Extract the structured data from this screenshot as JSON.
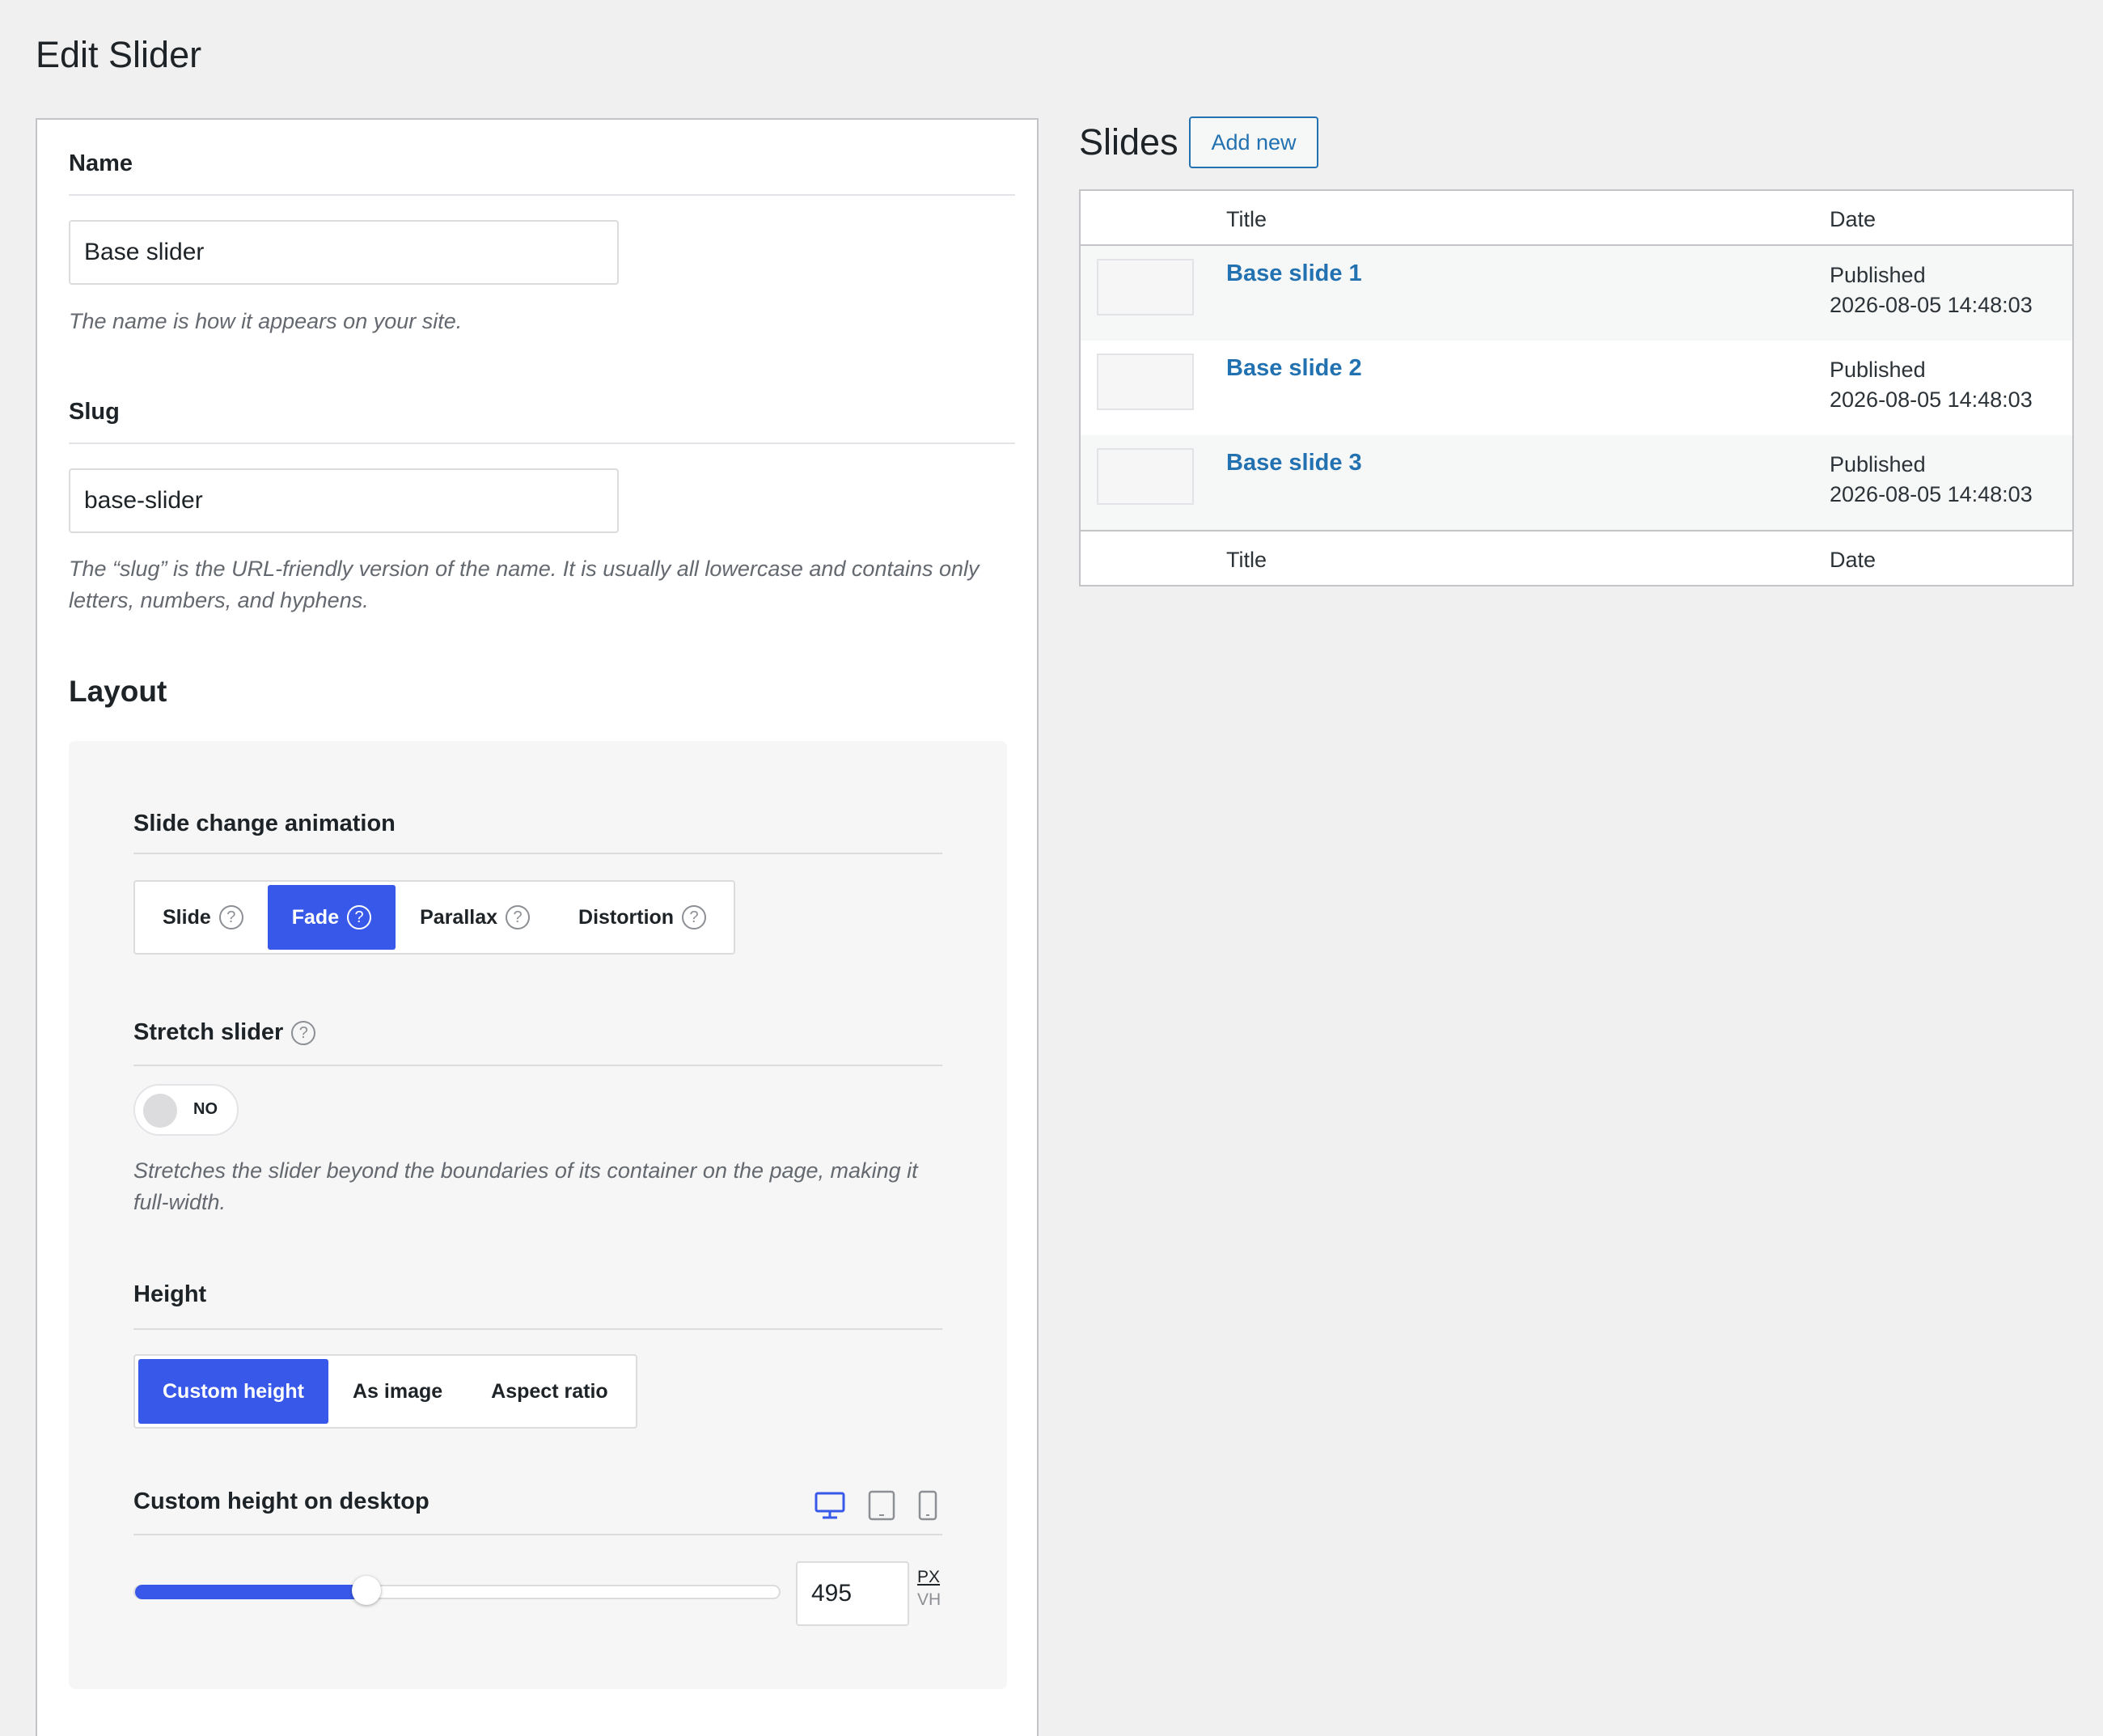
{
  "page": {
    "title": "Edit Slider"
  },
  "form": {
    "name_label": "Name",
    "name_value": "Base slider",
    "name_help": "The name is how it appears on your site.",
    "slug_label": "Slug",
    "slug_value": "base-slider",
    "slug_help": "The “slug” is the URL-friendly version of the name. It is usually all lowercase and contains only letters, numbers, and hyphens."
  },
  "layout": {
    "title": "Layout",
    "animation_label": "Slide change animation",
    "animation_options": [
      "Slide",
      "Fade",
      "Parallax",
      "Distortion"
    ],
    "animation_selected": "Fade",
    "stretch_label": "Stretch slider",
    "stretch_value": "NO",
    "stretch_help": "Stretches the slider beyond the boundaries of its container on the page, making it full-width.",
    "height_label": "Height",
    "height_options": [
      "Custom height",
      "As image",
      "Aspect ratio"
    ],
    "height_selected": "Custom height",
    "custom_height_label": "Custom height on desktop",
    "device_icons": [
      "desktop-icon",
      "tablet-icon",
      "mobile-icon"
    ],
    "device_selected": "desktop-icon",
    "custom_height_value": "495",
    "slider_fraction": 0.357,
    "unit_px": "PX",
    "unit_vh": "VH",
    "unit_selected": "PX"
  },
  "slides": {
    "title": "Slides",
    "add_new_label": "Add new",
    "columns": [
      "Title",
      "Date"
    ],
    "rows": [
      {
        "title": "Base slide 1",
        "status": "Published",
        "date": "2026-08-05 14:48:03"
      },
      {
        "title": "Base slide 2",
        "status": "Published",
        "date": "2026-08-05 14:48:03"
      },
      {
        "title": "Base slide 3",
        "status": "Published",
        "date": "2026-08-05 14:48:03"
      }
    ]
  },
  "colors": {
    "accent": "#3858e9",
    "link": "#2271b1",
    "background": "#f0f0f1"
  }
}
